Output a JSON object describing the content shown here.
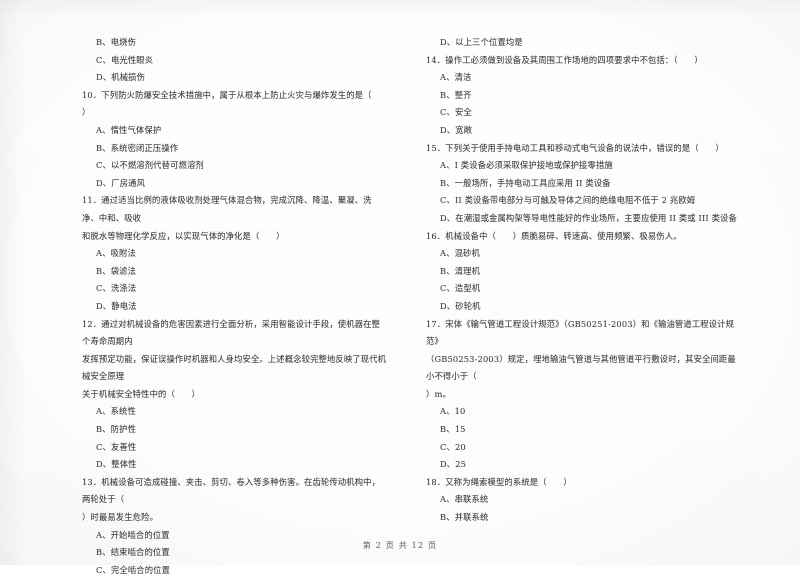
{
  "document": {
    "type": "scanned-exam-paper",
    "footer": "第 2 页 共 12 页"
  },
  "left_column": {
    "orphan_options": [
      "B、电烧伤",
      "C、电光性眼炎",
      "D、机械损伤"
    ],
    "questions": [
      {
        "number": "10",
        "stem": "10．下列防火防爆安全技术措施中，属于从根本上防止火灾与爆炸发生的是（      ）",
        "options": [
          "A、惰性气体保护",
          "B、系统密闭正压操作",
          "C、以不燃溶剂代替可燃溶剂",
          "D、厂房通风"
        ]
      },
      {
        "number": "11",
        "stem": "11．通过适当比例的液体吸收剂处理气体混合物，完成沉降、降温、聚凝、洗净、中和、吸收\n和脱水等物理化学反应，以实现气体的净化是（      ）",
        "options": [
          "A、吸附法",
          "B、袋滤法",
          "C、洗涤法",
          "D、静电法"
        ]
      },
      {
        "number": "12",
        "stem": "12．通过对机械设备的危害因素进行全面分析，采用智能设计手段，使机器在整个寿命周期内\n发挥预定功能，保证误操作时机器和人身均安全。上述概念较完整地反映了现代机械安全原理\n关于机械安全特性中的（      ）",
        "options": [
          "A、系统性",
          "B、防护性",
          "C、友善性",
          "D、整体性"
        ]
      },
      {
        "number": "13",
        "stem": "13．机械设备可造成碰撞、夹击、剪切、卷入等多种伤害。在齿轮传动机构中，两轮处于（\n）时最易发生危险。",
        "options": [
          "A、开始啮合的位置",
          "B、结束啮合的位置",
          "C、完全啮合的位置"
        ]
      }
    ]
  },
  "right_column": {
    "orphan_options": [
      "D、以上三个位置均是"
    ],
    "questions": [
      {
        "number": "14",
        "stem": "14．操作工必须做到设备及其周围工作场地的四项要求中不包括：（      ）",
        "options": [
          "A、清洁",
          "B、整齐",
          "C、安全",
          "D、宽敞"
        ]
      },
      {
        "number": "15",
        "stem": "15．下列关于使用手持电动工具和移动式电气设备的说法中，错误的是（      ）",
        "options": [
          "A、I 类设备必须采取保护接地或保护接零措施",
          "B、一般场所，手持电动工具应采用 II 类设备",
          "C、II 类设备带电部分与可触及导体之间的绝缘电阻不低于 2 兆欧姆",
          "D、在潮湿或金属构架等导电性能好的作业场所，主要应使用 II 类或 III 类设备"
        ]
      },
      {
        "number": "16",
        "stem": "16．机械设备中（      ）质脆易碎、转速高、使用频繁、极易伤人。",
        "options": [
          "A、混砂机",
          "B、清理机",
          "C、造型机",
          "D、砂轮机"
        ]
      },
      {
        "number": "17",
        "stem": "17．宋体《输气管道工程设计规范》（GB50251-2003）和《输油管道工程设计规范》\n（GB50253-2003）规定，埋地输油气管道与其他管道平行敷设时，其安全间距最小不得小于（\n）m。",
        "options": [
          "A、10",
          "B、15",
          "C、20",
          "D、25"
        ]
      },
      {
        "number": "18",
        "stem": "18．又称为绳索模型的系统是（      ）",
        "options": [
          "A、串联系统",
          "B、并联系统"
        ]
      }
    ]
  }
}
